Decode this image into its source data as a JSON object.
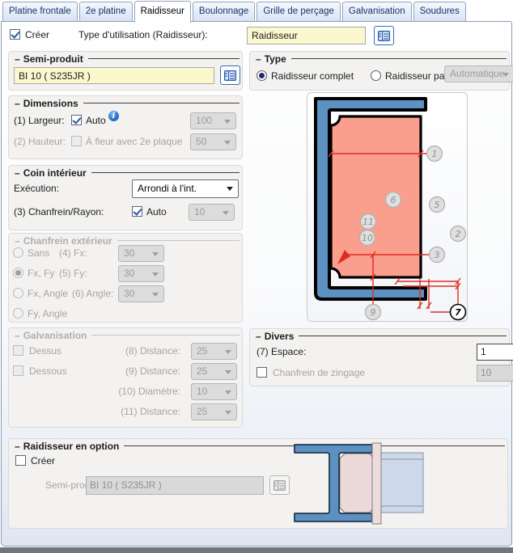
{
  "ui": {
    "dash": "–",
    "info_glyph": "i"
  },
  "colors": {
    "accent": "#2b5cb0",
    "tabText": "#17356e",
    "checkBlue": "#2a56a9",
    "yellow": "#fbf8cd",
    "steelBlue": "#5d91c2",
    "salmon": "#fa9f8d",
    "dimRed": "#e02b20"
  },
  "tabs": [
    {
      "label": "Platine frontale",
      "active": false
    },
    {
      "label": "2e platine",
      "active": false
    },
    {
      "label": "Raidisseur",
      "active": true
    },
    {
      "label": "Boulonnage",
      "active": false
    },
    {
      "label": "Grille de perçage",
      "active": false
    },
    {
      "label": "Galvanisation",
      "active": false
    },
    {
      "label": "Soudures",
      "active": false
    }
  ],
  "header": {
    "create_label": "Créer",
    "type_usage_label": "Type d'utilisation (Raidisseur):",
    "type_usage_value": "Raidisseur"
  },
  "groups": {
    "semi_produit": {
      "title": "Semi-produit",
      "value": "BI 10  ( S235JR )"
    },
    "dimensions": {
      "title": "Dimensions",
      "largeur_label": "(1) Largeur:",
      "auto_label": "Auto",
      "largeur_value": "100",
      "hauteur_label": "(2) Hauteur:",
      "fleur_label": "À fleur avec 2e plaque",
      "hauteur_value": "50"
    },
    "coin_interieur": {
      "title": "Coin intérieur",
      "execution_label": "Exécution:",
      "execution_value": "Arrondi à l'int.",
      "chanfrein_label": "(3) Chanfrein/Rayon:",
      "auto_label": "Auto",
      "chanfrein_value": "10"
    },
    "chanfrein_exterieur": {
      "title": "Chanfrein extérieur",
      "rows": [
        {
          "radio": "Sans",
          "label": "(4) Fx:",
          "value": "30"
        },
        {
          "radio": "Fx, Fy",
          "label": "(5) Fy:",
          "value": "30"
        },
        {
          "radio": "Fx, Angle",
          "label": "(6) Angle:",
          "value": "30"
        },
        {
          "radio": "Fy, Angle"
        }
      ]
    },
    "galvanisation": {
      "title": "Galvanisation",
      "checks": [
        "Dessus",
        "Dessous"
      ],
      "rows": [
        {
          "label": "(8) Distance:",
          "value": "25"
        },
        {
          "label": "(9) Distance:",
          "value": "25"
        },
        {
          "label": "(10) Diamètre:",
          "value": "10"
        },
        {
          "label": "(11) Distance:",
          "value": "25"
        }
      ]
    },
    "type": {
      "title": "Type",
      "complet_label": "Raidisseur complet",
      "partiel_label": "Raidisseur partiel",
      "mode_value": "Automatique"
    },
    "divers": {
      "title": "Divers",
      "espace_label": "(7) Espace:",
      "espace_value": "1",
      "zingage_label": "Chanfrein de zingage",
      "zingage_value": "10"
    },
    "option": {
      "title": "Raidisseur en option",
      "creer_label": "Créer",
      "semi_label": "Semi-produit:",
      "semi_value": "BI 10  ( S235JR )"
    }
  },
  "diagram": {
    "callouts": {
      "c1": "1",
      "c2": "2",
      "c3": "3",
      "c5": "5",
      "c6": "6",
      "c7": "7",
      "c9": "9",
      "c10": "10",
      "c11": "11"
    }
  }
}
